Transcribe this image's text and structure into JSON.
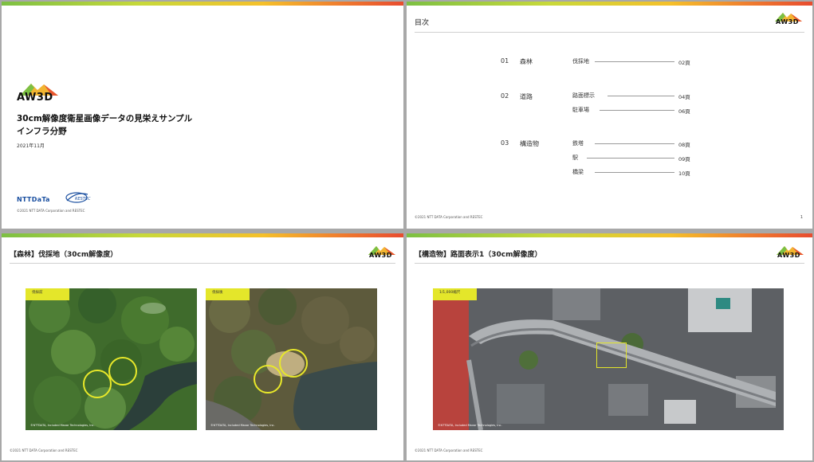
{
  "colors": {
    "accent_yellow": "#e4e62a",
    "rule": "#cfcfcf"
  },
  "logo": {
    "text": "AW3D"
  },
  "slide1": {
    "title_line1": "30cm解像度衛星画像データの見栄えサンプル",
    "title_line2": "インフラ分野",
    "date": "2021年11月",
    "ntt_logo": "NTTDaTa",
    "footer": "©2021 NTT DATA Corporation and RESTEC"
  },
  "slide2": {
    "title": "目次",
    "sections": [
      {
        "num": "01",
        "name": "森林",
        "items": [
          {
            "label": "伐採地",
            "page": "02頁"
          }
        ]
      },
      {
        "num": "02",
        "name": "道路",
        "items": [
          {
            "label": "路面標示",
            "page": "04頁"
          },
          {
            "label": "駐車場",
            "page": "06頁"
          }
        ]
      },
      {
        "num": "03",
        "name": "構造物",
        "items": [
          {
            "label": "鉄塔",
            "page": "08頁"
          },
          {
            "label": "駅",
            "page": "09頁"
          },
          {
            "label": "橋梁",
            "page": "10頁"
          }
        ]
      }
    ],
    "footer": "©2021 NTT DATA Corporation and RESTEC",
    "page_number": "1"
  },
  "slide3": {
    "title": "【森林】伐採地（30cm解像度）",
    "image1_tag": "伐採前",
    "image2_tag": "伐採後",
    "credit": "©NTTDATA, Included Maxar Technologies, Inc.",
    "footer": "©2021 NTT DATA Corporation and RESTEC"
  },
  "slide4": {
    "title": "【構造物】路面表示1（30cm解像度）",
    "image_tag": "1/1,000縮尺",
    "credit": "©NTTDATA, Included Maxar Technologies, Inc.",
    "footer": "©2021 NTT DATA Corporation and RESTEC"
  }
}
